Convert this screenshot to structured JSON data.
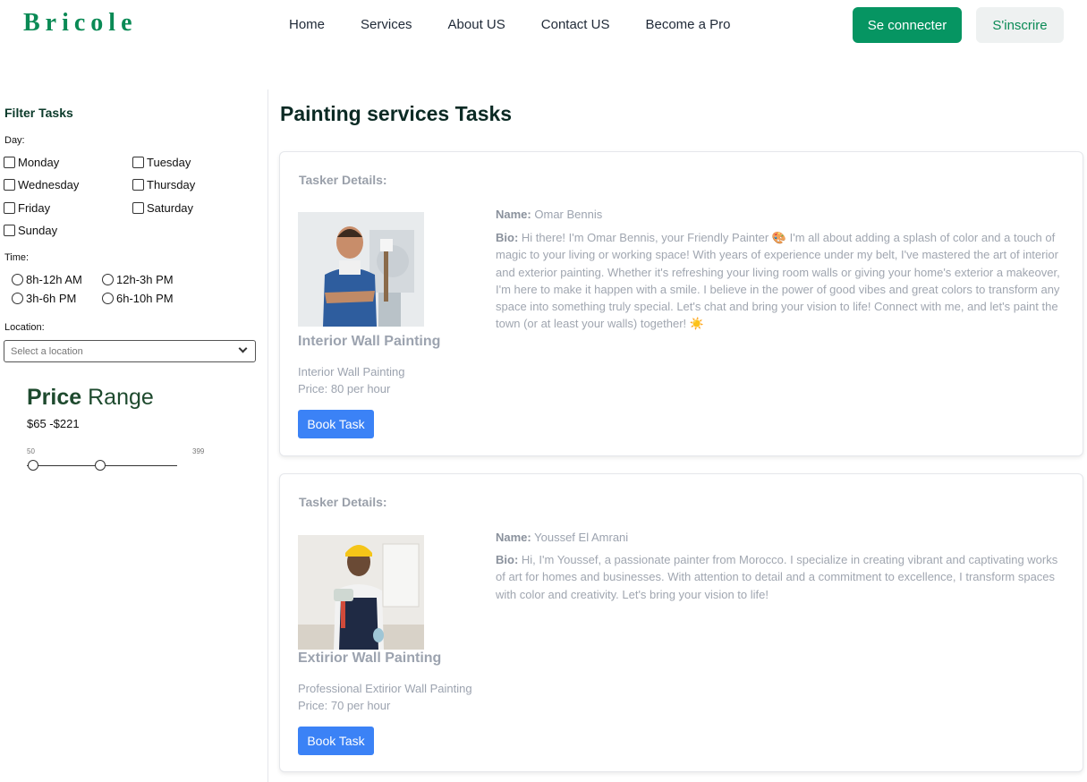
{
  "header": {
    "logo": "Bricole",
    "nav": [
      "Home",
      "Services",
      "About US",
      "Contact US",
      "Become a Pro"
    ],
    "login_label": "Se connecter",
    "signup_label": "S'inscrire",
    "brand_color": "#069562"
  },
  "sidebar": {
    "title": "Filter Tasks",
    "day_label": "Day:",
    "days": [
      "Monday",
      "Tuesday",
      "Wednesday",
      "Thursday",
      "Friday",
      "Saturday",
      "Sunday"
    ],
    "time_label": "Time:",
    "times": [
      "8h-12h AM",
      "12h-3h PM",
      "3h-6h PM",
      "6h-10h PM"
    ],
    "location_label": "Location:",
    "location_placeholder": "Select a location",
    "price_title_bold": "Price",
    "price_title_rest": " Range",
    "price_range_text": "$65 -$221",
    "slider_min": "50",
    "slider_max": "399",
    "slider_low_value": 65,
    "slider_high_value": 221
  },
  "main": {
    "title": "Painting services Tasks",
    "cards": [
      {
        "label": "Tasker Details:",
        "service_title": "Interior Wall Painting",
        "service_desc": "Interior Wall Painting",
        "price": "Price: 80 per hour",
        "book_label": "Book Task",
        "name_key": "Name:",
        "name": "Omar Bennis",
        "bio_key": "Bio:",
        "bio": "Hi there! I'm Omar Bennis, your Friendly Painter 🎨 I'm all about adding a splash of color and a touch of magic to your living or working space! With years of experience under my belt, I've mastered the art of interior and exterior painting. Whether it's refreshing your living room walls or giving your home's exterior a makeover, I'm here to make it happen with a smile. I believe in the power of good vibes and great colors to transform any space into something truly special. Let's chat and bring your vision to life! Connect with me, and let's paint the town (or at least your walls) together! ☀️"
      },
      {
        "label": "Tasker Details:",
        "service_title": "Extirior Wall Painting",
        "service_desc": "Professional Extirior Wall Painting",
        "price": "Price: 70 per hour",
        "book_label": "Book Task",
        "name_key": "Name:",
        "name": "Youssef El Amrani",
        "bio_key": "Bio:",
        "bio": "Hi, I'm Youssef, a passionate painter from Morocco. I specialize in creating vibrant and captivating works of art for homes and businesses. With attention to detail and a commitment to excellence, I transform spaces with color and creativity. Let's bring your vision to life!"
      }
    ]
  }
}
